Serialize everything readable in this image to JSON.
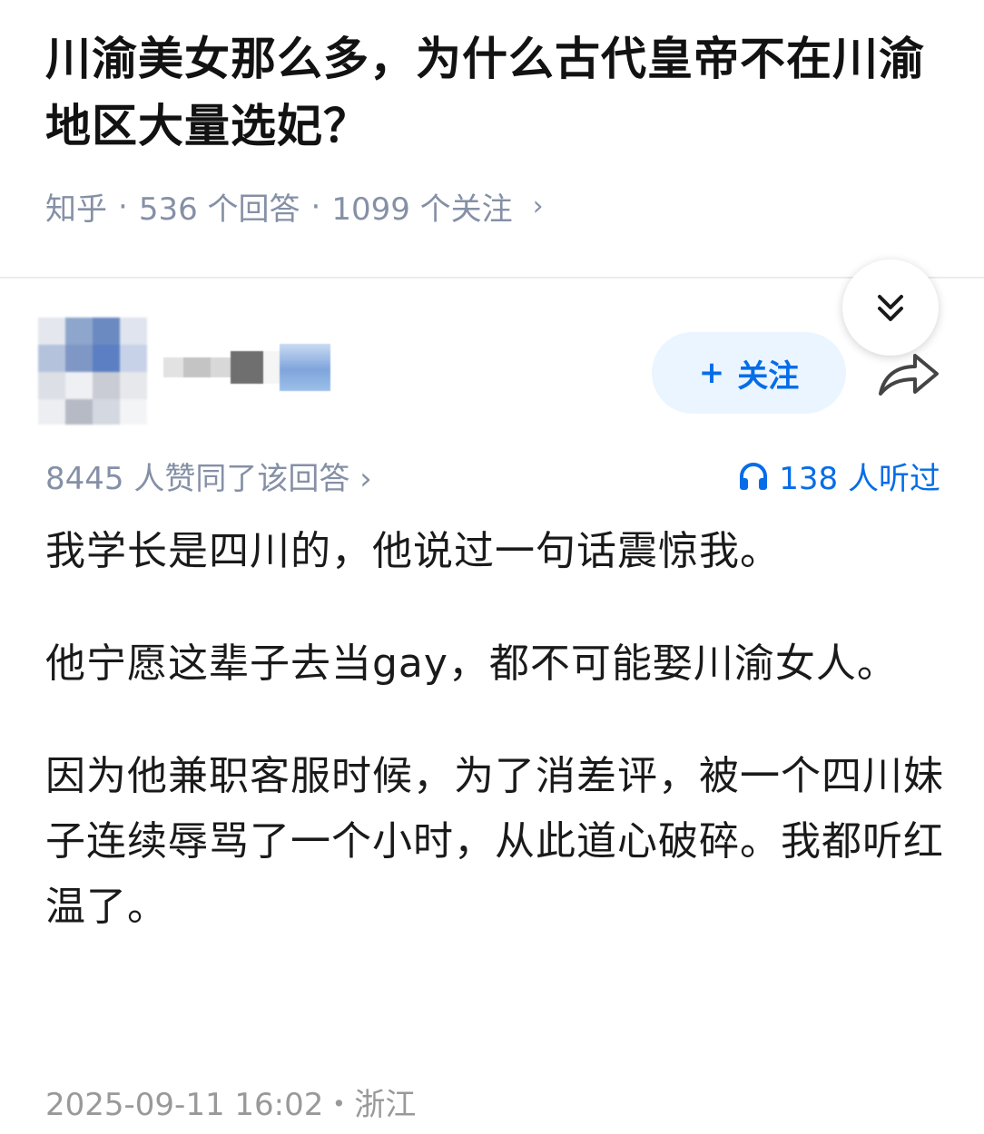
{
  "question": {
    "title": "川渝美女那么多，为什么古代皇帝不在川渝地区大量选妃？",
    "platform": "知乎",
    "answers": "536 个回答",
    "followers": "1099 个关注",
    "separator": "·",
    "chevron": "›"
  },
  "author": {
    "follow_label": "关注",
    "follow_plus": "+"
  },
  "answer": {
    "likes": "8445 人赞同了该回答 ›",
    "listened": "138 人听过",
    "paragraphs": [
      "我学长是四川的，他说过一句话震惊我。",
      "他宁愿这辈子去当gay，都不可能娶川渝女人。",
      "因为他兼职客服时候，为了消差评，被一个四川妹子连续辱骂了一个小时，从此道心破碎。我都听红温了。"
    ],
    "footer": "2025-09-11 16:02・浙江"
  },
  "icons": {
    "collapse": "double-chevron-down-icon",
    "share": "share-arrow-icon",
    "headphones": "headphones-icon"
  },
  "colors": {
    "accent": "#056de8",
    "follow_bg": "#ebf5ff",
    "meta_gray": "#8590a6",
    "footer_gray": "#999999"
  }
}
